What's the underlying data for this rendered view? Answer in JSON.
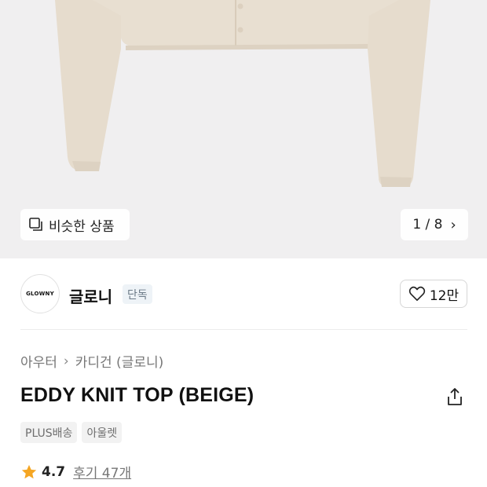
{
  "hero": {
    "similar_label": "비슷한 상품",
    "counter": "1 / 8",
    "next_glyph": "›",
    "bg_color": "#f0eff0",
    "garment_color": "#e8dfd1"
  },
  "brand": {
    "logo_text": "GLOWNY",
    "name": "글로니",
    "badge": "단독",
    "likes": "12만"
  },
  "breadcrumb": {
    "parent": "아우터",
    "separator": "›",
    "current": "카디건 (글로니)"
  },
  "product": {
    "title": "EDDY KNIT TOP (BEIGE)",
    "tags": [
      "PLUS배송",
      "아울렛"
    ]
  },
  "rating": {
    "score": "4.7",
    "reviews": "후기 47개",
    "star_color": "#f5a623"
  },
  "icons": {
    "similar": "similar-items-icon",
    "next": "chevron-right-icon",
    "like": "heart-icon",
    "share": "share-icon",
    "star": "star-icon"
  }
}
